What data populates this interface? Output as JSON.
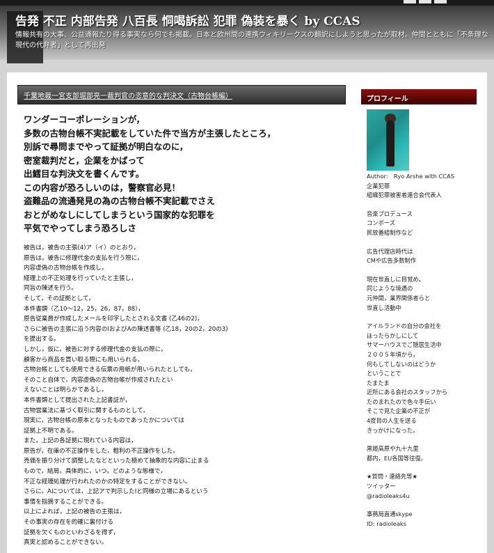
{
  "header": {
    "title": "告発 不正 内部告発 八百長 恫喝訴訟 犯罪 偽装を暴く by CCAS",
    "description": "情報共有の大事、公益通報たり得る事実なら何でも掲載。日本と欧州間の連携ウィキリークスの翻訳にしようと思ったが取材。仲間とともに「不条理な現代の代弁者」として再出発"
  },
  "post": {
    "title": "千葉地裁一宮支部堀部亮一裁判官の恣意的な判決文（古物台帳編）",
    "lead": [
      "ワンダーコーポレーションが，",
      "多数の古物台帳不実記載をしていた件で当方が主張したところ，",
      "別訴で尋問までやって証拠が明白なのに，",
      "密室裁判だと，企業をかばって",
      "出鱈目な判決文を書くんです。",
      "この内容が恐ろしいのは，警察官必見！",
      "盗難品の流通発見の為の古物台帳不実記載でさえ",
      "おとがめなしにしてしまうという国家的な犯罪を",
      "平気でやってしまう恐ろしさ"
    ],
    "body": [
      "被告は，被告の主張(4)ア（イ）のとおり，",
      "原告は，被告に修理代金の支払を行う際に，",
      "内容虚偽の古物台帳を作成し，",
      "経理上の不正処理を行っていたと主張し，",
      "同旨の陳述を行う。",
      "そして，その証拠として，",
      "本件書類（乙10～12，25，26，87，88），",
      "原告従業員が作成したメールを印字したとされる文書 (乙46の2)，",
      "さらに被告の主張に沿う内容のIおよびAの陳述書等 (乙18，20の2，20の3)",
      "を提出する。",
      "しかし，仮に，被告に対する修理代金の支払の際に，",
      "顧客から商品を買い取る際にも用いられる，",
      "古物台帳としても使用できる伝票の用紙が用いられたとしても，",
      "そのこと自体で，内容虚偽の古物台帳が作成されたとい",
      "えないことは明らかであるし，",
      "本件書類として提出された上記書証が，",
      "古物営業法に基づく取引に関するものとして，",
      "現実に，古物台帳の原本となったものであったかについては",
      "証拠上不明である。",
      "また，上記の各証拠に現れている内容は，",
      "原告が，在庫の不正操作をした，粗利の不正操作をした，",
      "売価を振り分けて調整したなどといった極めて抽象的な内容に止まる",
      "もので，結局，具体的に，いつ，どのような態様で，",
      "不正な経理処理が行われたのかの特定をすることができない。",
      "さらに，Aについては，上記アで判示したIと同様の立場にあるという",
      "事情を指摘することができる。",
      "以上によれば，上記の被告の主張は，",
      "その事実の存在を的確に裏付ける",
      "証拠を欠くものといわざるを得ず，",
      "真実と認めることができない。"
    ]
  },
  "sidebar": {
    "heading": "プロフィール",
    "blocks": [
      [
        "Author:　Ryo Arshe with CCAS",
        "企業犯罪",
        "組織犯罪被害者連合会代表人"
      ],
      [
        "音楽プロデュース",
        "コンポーズ",
        "民放番組制作など"
      ],
      [
        "広告代理店時代は",
        "CMや広告多数制作"
      ],
      [
        "現在世直しに目覚め，",
        "同じような境遇の",
        "元仲間，業界関係者らと",
        "世直し活動中"
      ],
      [
        "アイルランドの自分の会社を",
        "ほったらかしにして",
        "サマーハウスでご隠居生活中",
        "２００５年頃から，",
        "何もしてしないのはどうか",
        "ということで",
        "たまたま",
        "近所にある会社のスタッフから",
        "たのまれたので色々手伝い",
        "そこで見た企業の不正が",
        "4度目の人生を送る",
        "きっかけになった。"
      ],
      [
        "黒姫高原や九十九里",
        "都内，EU各国等往復。"
      ],
      [
        "★質問・連絡先等★",
        "ツイッター",
        "@radioleaks4u"
      ],
      [
        "事務局直通skype",
        "ID: radioleaks"
      ]
    ]
  }
}
